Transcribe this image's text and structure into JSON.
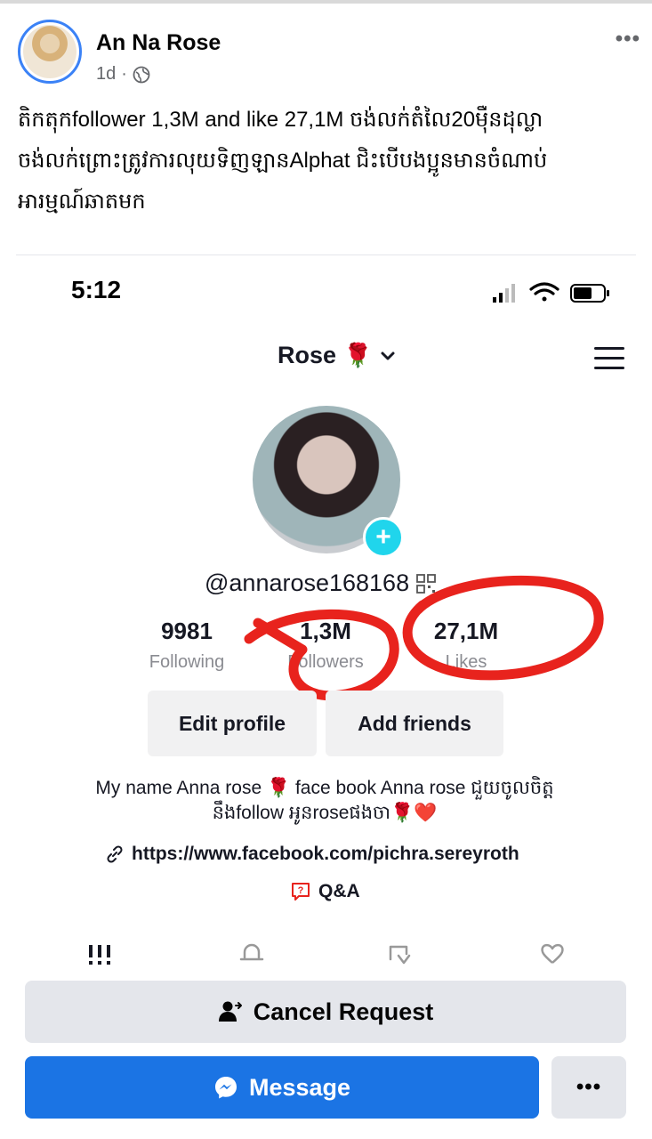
{
  "post": {
    "author": "An Na Rose",
    "time": "1d",
    "separator": "·",
    "more": "•••",
    "text_lines": [
      "តិកតុកfollower 1,3M and like 27,1M ចង់លក់តំលៃ20ម៉ឺនដុល្លា",
      "ចង់លក់ព្រោះត្រូវការលុយទិញឡានAlphat ជិះបើបងប្អូនមានចំណាប់",
      "អារម្មណ៍ឆាតមក"
    ]
  },
  "phone": {
    "time": "5:12"
  },
  "tiktok": {
    "profile_name": "Rose",
    "profile_emoji": "🌹",
    "plus": "+",
    "username": "@annarose168168",
    "stats": [
      {
        "value": "9981",
        "label": "Following"
      },
      {
        "value": "1,3M",
        "label": "Followers"
      },
      {
        "value": "27,1M",
        "label": "Likes"
      }
    ],
    "edit_profile": "Edit profile",
    "add_friends": "Add friends",
    "bio_line1": "My name Anna rose 🌹 face book Anna rose ជួយចូលចិត្ត",
    "bio_line2": "នឹងfollow អូនroseផងចា🌹❤️",
    "link": "https://www.facebook.com/pichra.sereyroth",
    "qa": "Q&A"
  },
  "actions": {
    "cancel_request": "Cancel Request",
    "message": "Message",
    "more": "•••"
  },
  "colors": {
    "messenger_blue": "#1b74e4",
    "button_gray": "#e4e6eb",
    "tiktok_cyan": "#20d5ec",
    "annotation_red": "#e8231d"
  }
}
